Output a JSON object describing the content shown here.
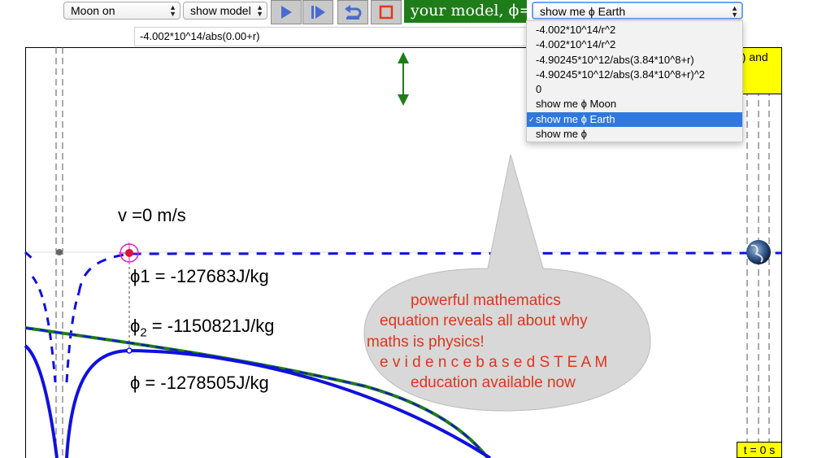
{
  "toolbar": {
    "moon_select": "Moon on",
    "model_select": "show model",
    "model_label": "your model, ϕ=",
    "phi_select": "show me ϕ Earth"
  },
  "formula": {
    "value": "-4.002*10^14/abs(0.00+r)"
  },
  "menu": {
    "items": [
      "-4.002*10^14/r^2",
      "-4.002*10^14/r^2",
      "-4.90245*10^12/abs(3.84*10^8+r)",
      "-4.90245*10^12/abs(3.84*10^8+r)^2",
      "0",
      "show me ϕ Moon",
      "show me ϕ Earth",
      "show me ϕ"
    ],
    "selected_index": 6
  },
  "plot": {
    "velocity": "v =0 m/s",
    "phi1": "ϕ1 = -127683J/kg",
    "phi2_prefix": "ϕ",
    "phi2_sub": "2",
    "phi2_suffix": " = -1150821J/kg",
    "phi_total": "ϕ = -1278505J/kg",
    "corner_text": "g) and",
    "time": "t = 0 s"
  },
  "bubble": {
    "line1": "powerful  mathematics",
    "line2": "equation  reveals  all  about  why",
    "line3": "maths is physics!",
    "line4": "e v i d e n c e   b a s e d   S T E A M",
    "line5": "education available now"
  },
  "colors": {
    "accent_green": "#1e7d18",
    "curve_blue": "#1010e0",
    "bubble_text": "#e0341e",
    "highlight": "#ffff00"
  }
}
